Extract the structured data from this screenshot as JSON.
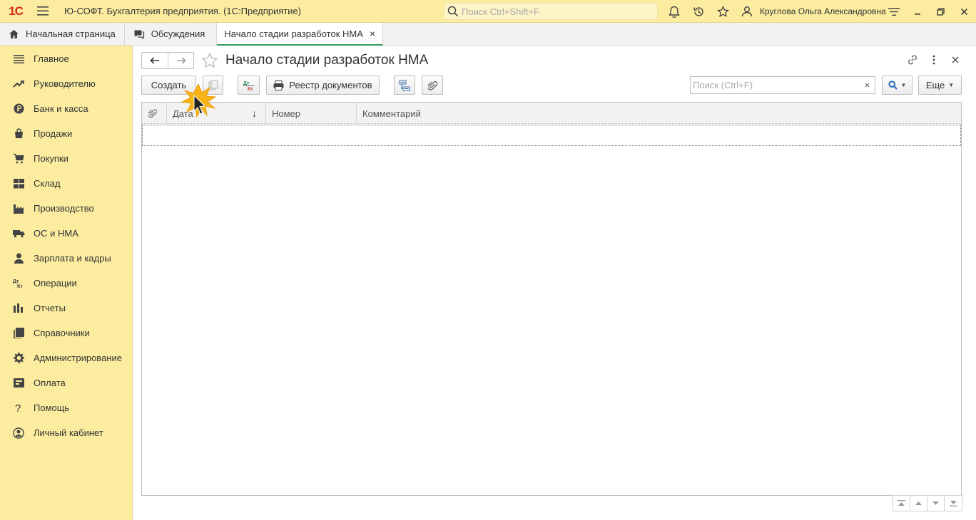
{
  "topbar": {
    "logo": "1С",
    "app_title": "Ю-СОФТ. Бухгалтерия предприятия.  (1С:Предприятие)",
    "search_placeholder": "Поиск Ctrl+Shift+F",
    "user_name": "Круглова Ольга Александровна",
    "icons": [
      "bell-icon",
      "history-icon",
      "star-icon",
      "user-icon",
      "settings-icon"
    ],
    "window_controls": [
      "minimize",
      "restore",
      "close"
    ]
  },
  "tabs": [
    {
      "label": "Начальная страница",
      "icon": "home-icon"
    },
    {
      "label": "Обсуждения",
      "icon": "chat-icon"
    },
    {
      "label": "Начало стадии разработок НМА",
      "active": true,
      "close": "×"
    }
  ],
  "sidebar": {
    "items": [
      {
        "label": "Главное",
        "icon": "menu-lines-icon"
      },
      {
        "label": "Руководителю",
        "icon": "trend-icon"
      },
      {
        "label": "Банк и касса",
        "icon": "ruble-icon"
      },
      {
        "label": "Продажи",
        "icon": "bag-icon"
      },
      {
        "label": "Покупки",
        "icon": "cart-icon"
      },
      {
        "label": "Склад",
        "icon": "grid-icon"
      },
      {
        "label": "Производство",
        "icon": "factory-icon"
      },
      {
        "label": "ОС и НМА",
        "icon": "truck-icon"
      },
      {
        "label": "Зарплата и кадры",
        "icon": "person-icon"
      },
      {
        "label": "Операции",
        "icon": "dtkt-icon"
      },
      {
        "label": "Отчеты",
        "icon": "bar-chart-icon"
      },
      {
        "label": "Справочники",
        "icon": "book-icon"
      },
      {
        "label": "Администрирование",
        "icon": "gear-icon"
      },
      {
        "label": "Оплата",
        "icon": "card-icon"
      },
      {
        "label": "Помощь",
        "icon": "question-icon"
      },
      {
        "label": "Личный кабинет",
        "icon": "account-icon"
      }
    ]
  },
  "page": {
    "title": "Начало стадии разработок НМА"
  },
  "toolbar": {
    "create_label": "Создать",
    "dtkt_top": "Дт",
    "dtkt_bottom": "Кт",
    "registry_label": "Реестр документов",
    "search_placeholder": "Поиск (Ctrl+F)",
    "search_clear": "×",
    "more_label": "Еще"
  },
  "table": {
    "columns": [
      {
        "label": ""
      },
      {
        "label": "Дата",
        "sort": "↓"
      },
      {
        "label": "Номер"
      },
      {
        "label": "Комментарий"
      }
    ],
    "rows": []
  },
  "colors": {
    "topbar_bg": "#fbeca0",
    "sidebar_bg": "#fbeca0",
    "active_tab_underline": "#2f9d5c",
    "logo_red": "#d9261c",
    "search_accent": "#2b6cc4"
  }
}
